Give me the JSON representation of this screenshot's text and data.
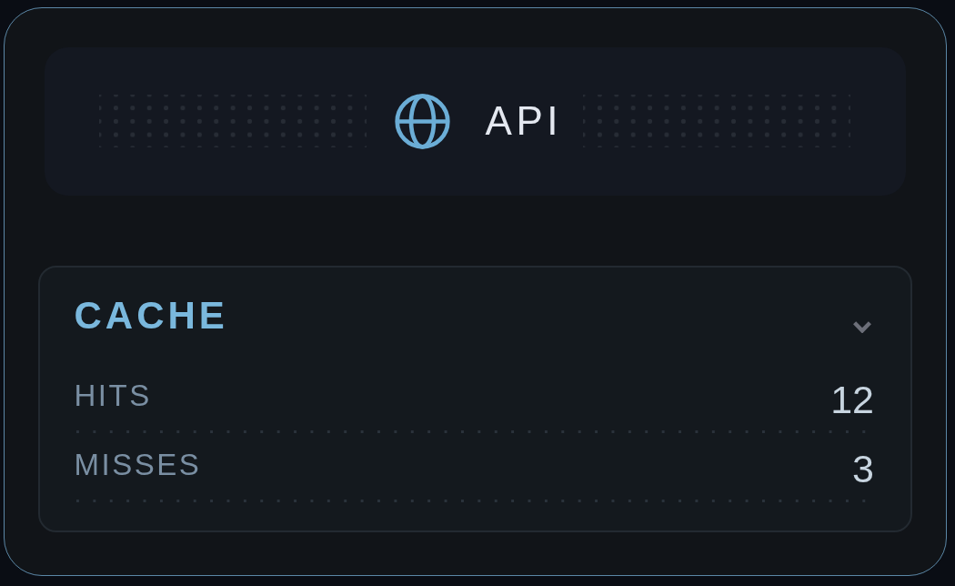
{
  "header": {
    "title": "API"
  },
  "section": {
    "title": "CACHE",
    "expanded": true,
    "rows": [
      {
        "label": "HITS",
        "value": "12"
      },
      {
        "label": "MISSES",
        "value": "3"
      }
    ]
  }
}
